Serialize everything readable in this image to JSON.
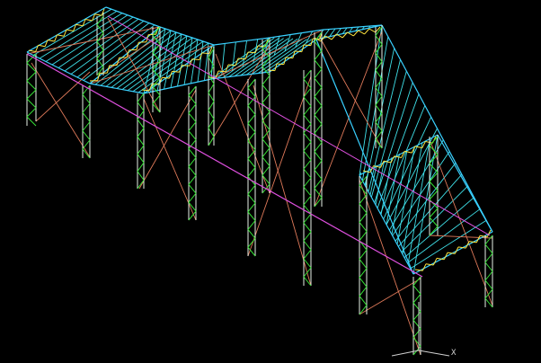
{
  "view": {
    "background": "#000000",
    "colors": {
      "roof_member": "#39d0ff",
      "purlin": "#3fe0e8",
      "column": "#e8f2e8",
      "column_lacing": "#35e035",
      "truss_web": "#ffe640",
      "brace_red": "#e07a5a",
      "ridge_magenta": "#e050e0",
      "ucs": "#d0d0d0"
    },
    "icons": {
      "ucs_axis": "ucs-axis-icon"
    }
  },
  "ucs": {
    "x_label": "X"
  }
}
